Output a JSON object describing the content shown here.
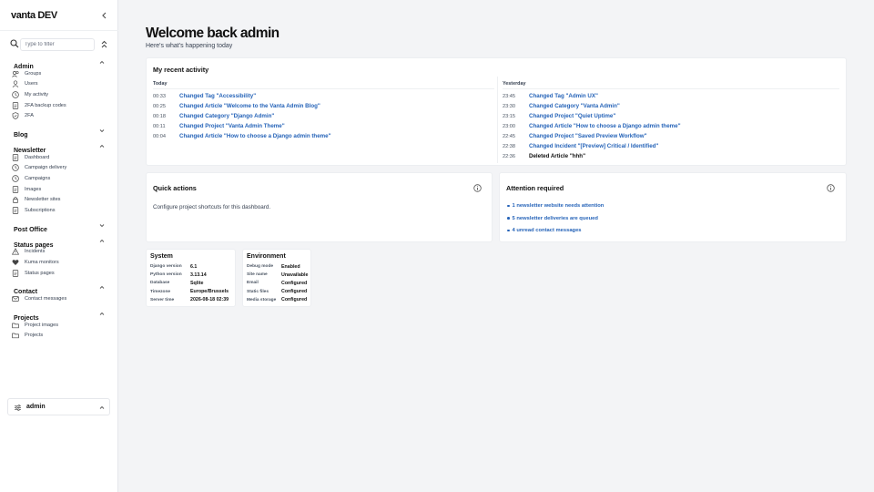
{
  "app": {
    "brand": "vanta DEV"
  },
  "sidebar": {
    "filter_placeholder": "Type to filter",
    "groups": [
      {
        "title": "Admin",
        "expanded": true,
        "items": [
          {
            "label": "Groups",
            "icon": "users-icon"
          },
          {
            "label": "Users",
            "icon": "user-icon"
          },
          {
            "label": "My activity",
            "icon": "clock-icon"
          },
          {
            "label": "2FA backup codes",
            "icon": "document-icon"
          },
          {
            "label": "2FA",
            "icon": "shield-icon"
          }
        ]
      },
      {
        "title": "Blog",
        "expanded": false,
        "items": []
      },
      {
        "title": "Newsletter",
        "expanded": true,
        "items": [
          {
            "label": "Dashboard",
            "icon": "document-icon"
          },
          {
            "label": "Campaign delivery",
            "icon": "clock-icon"
          },
          {
            "label": "Campaigns",
            "icon": "clock-icon"
          },
          {
            "label": "Images",
            "icon": "document-icon"
          },
          {
            "label": "Newsletter sites",
            "icon": "lock-icon"
          },
          {
            "label": "Subscriptions",
            "icon": "document-icon"
          }
        ]
      },
      {
        "title": "Post Office",
        "expanded": false,
        "items": []
      },
      {
        "title": "Status pages",
        "expanded": true,
        "items": [
          {
            "label": "Incidents",
            "icon": "warning-icon"
          },
          {
            "label": "Kuma monitors",
            "icon": "heart-icon"
          },
          {
            "label": "Status pages",
            "icon": "document-icon"
          }
        ]
      },
      {
        "title": "Contact",
        "expanded": true,
        "items": [
          {
            "label": "Contact messages",
            "icon": "mail-icon"
          }
        ]
      },
      {
        "title": "Projects",
        "expanded": true,
        "items": [
          {
            "label": "Project images",
            "icon": "folder-icon"
          },
          {
            "label": "Projects",
            "icon": "folder-icon"
          }
        ]
      }
    ],
    "user": {
      "name": "admin"
    }
  },
  "main": {
    "title": "Welcome back admin",
    "subtitle": "Here's what's happening today",
    "activity": {
      "title": "My recent activity",
      "today": {
        "heading": "Today",
        "rows": [
          {
            "time": "00:33",
            "text": "Changed Tag \"Accessibility\"",
            "link": true
          },
          {
            "time": "00:25",
            "text": "Changed Article \"Welcome to the Vanta Admin Blog\"",
            "link": true
          },
          {
            "time": "00:18",
            "text": "Changed Category \"Django Admin\"",
            "link": true
          },
          {
            "time": "00:11",
            "text": "Changed Project \"Vanta Admin Theme\"",
            "link": true
          },
          {
            "time": "00:04",
            "text": "Changed Article \"How to choose a Django admin theme\"",
            "link": true
          }
        ]
      },
      "yesterday": {
        "heading": "Yesterday",
        "rows": [
          {
            "time": "23:45",
            "text": "Changed Tag \"Admin UX\"",
            "link": true
          },
          {
            "time": "23:30",
            "text": "Changed Category \"Vanta Admin\"",
            "link": true
          },
          {
            "time": "23:15",
            "text": "Changed Project \"Quiet Uptime\"",
            "link": true
          },
          {
            "time": "23:00",
            "text": "Changed Article \"How to choose a Django admin theme\"",
            "link": true
          },
          {
            "time": "22:45",
            "text": "Changed Project \"Saved Preview Workflow\"",
            "link": true
          },
          {
            "time": "22:38",
            "text": "Changed Incident \"[Preview] Critical / Identified\"",
            "link": true
          },
          {
            "time": "22:36",
            "text": "Deleted Article \"hhh\"",
            "link": false
          }
        ]
      }
    },
    "quick_actions": {
      "title": "Quick actions",
      "text": "Configure project shortcuts for this dashboard."
    },
    "attention": {
      "title": "Attention required",
      "items": [
        "1 newsletter website needs attention",
        "5 newsletter deliveries are queued",
        "4 unread contact messages"
      ]
    },
    "system": {
      "title": "System",
      "rows": [
        {
          "key": "Django version",
          "value": "6.1"
        },
        {
          "key": "Python version",
          "value": "3.13.14"
        },
        {
          "key": "Database",
          "value": "Sqlite"
        },
        {
          "key": "Timezone",
          "value": "Europe/Brussels"
        },
        {
          "key": "Server time",
          "value": "2026-08-18 02:39"
        }
      ]
    },
    "environment": {
      "title": "Environment",
      "rows": [
        {
          "key": "Debug mode",
          "value": "Enabled"
        },
        {
          "key": "Site name",
          "value": "Unavailable"
        },
        {
          "key": "Email",
          "value": "Configured"
        },
        {
          "key": "Static files",
          "value": "Configured"
        },
        {
          "key": "Media storage",
          "value": "Configured"
        }
      ]
    }
  },
  "colors": {
    "link": "#2563b8",
    "background": "#f3f4f6",
    "card": "#ffffff"
  }
}
